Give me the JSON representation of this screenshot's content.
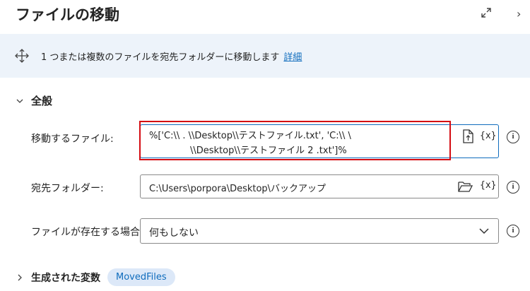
{
  "header": {
    "title": "ファイルの移動"
  },
  "info": {
    "text": "1 つまたは複数のファイルを宛先フォルダーに移動します",
    "link": "詳細"
  },
  "general": {
    "title": "全般"
  },
  "fields": {
    "files_to_move": {
      "label": "移動するファイル:",
      "line1": "%['C:\\\\            .           \\\\Desktop\\\\テストファイル.txt', 'C:\\\\        \\",
      "line2": "\\\\Desktop\\\\テストファイル 2 .txt']%",
      "var_button": "{x}"
    },
    "destination": {
      "label": "宛先フォルダー:",
      "value": "C:\\Users\\porpora\\Desktop\\バックアップ",
      "var_button": "{x}"
    },
    "if_exists": {
      "label": "ファイルが存在する場合:",
      "value": "何もしない"
    }
  },
  "variables": {
    "title": "生成された変数",
    "badge": "MovedFiles"
  },
  "icons": {
    "help": "i"
  }
}
